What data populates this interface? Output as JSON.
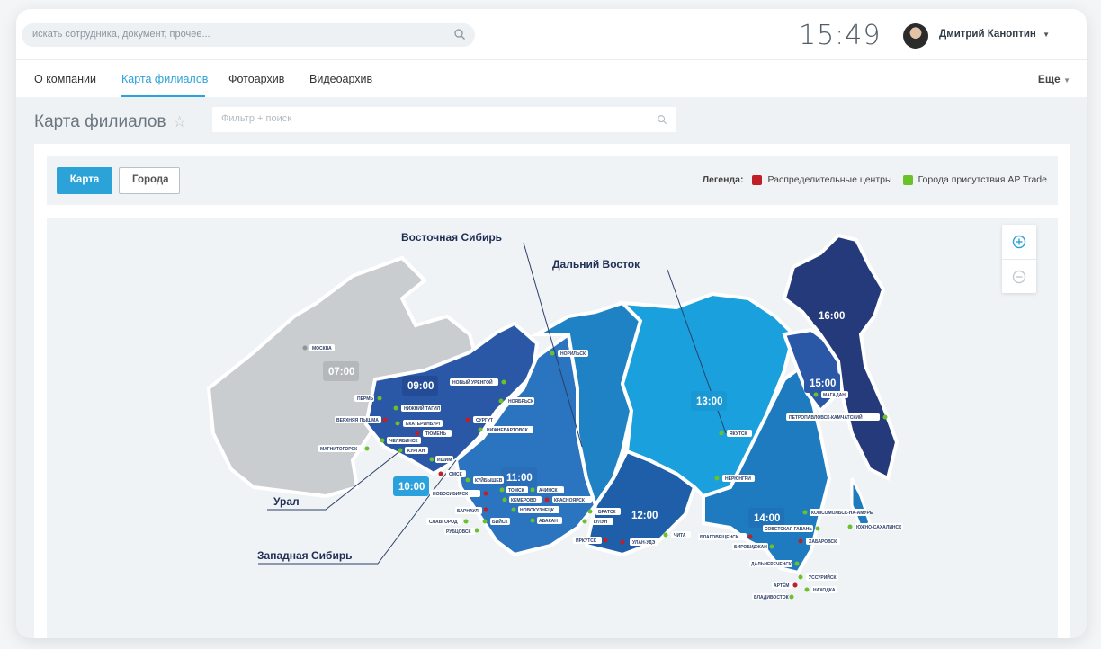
{
  "topbar": {
    "search_placeholder": "искать сотрудника, документ, прочее...",
    "clock": "15:49",
    "user_name": "Дмитрий Каноптин"
  },
  "tabs": {
    "items": [
      "О компании",
      "Карта филиалов",
      "Фотоархив",
      "Видеоархив"
    ],
    "active": "Карта филиалов",
    "more": "Еще"
  },
  "page": {
    "title": "Карта филиалов",
    "filter_placeholder": "Фильтр + поиск"
  },
  "toolbar": {
    "map_button": "Карта",
    "cities_button": "Города"
  },
  "legend": {
    "title": "Легенда:",
    "items": [
      {
        "label": "Распределительные центры",
        "color": "#c01f26"
      },
      {
        "label": "Города присутствия AP Trade",
        "color": "#6ac12a"
      }
    ]
  },
  "map": {
    "region_labels": [
      "Восточная Сибирь",
      "Дальний Восток",
      "Урал",
      "Западная Сибирь"
    ],
    "time_zones": [
      "07:00",
      "09:00",
      "10:00",
      "11:00",
      "12:00",
      "13:00",
      "14:00",
      "15:00",
      "16:00"
    ],
    "cities": [
      "МОСКВА",
      "ПЕРМЬ",
      "НИЖНИЙ ТАГИЛ",
      "ВЕРХНЯЯ ПЫШМА",
      "ЕКАТЕРИНБУРГ",
      "ТЮМЕНЬ",
      "ЧЕЛЯБИНСК",
      "КУРГАН",
      "МАГНИТОГОРСК",
      "ИШИМ",
      "НОВЫЙ УРЕНГОЙ",
      "НОЯБРЬСК",
      "СУРГУТ",
      "НИЖНЕВАРТОВСК",
      "ОМСК",
      "КУЙБЫШЕВ",
      "НОВОСИБИРСК",
      "ТОМСК",
      "АЧИНСК",
      "КЕМЕРОВО",
      "КРАСНОЯРСК",
      "НОВОКУЗНЕЦК",
      "БАРНАУЛ",
      "СЛАВГОРОД",
      "БИЙСК",
      "РУБЦОВСК",
      "АБАКАН",
      "БРАТСК",
      "ТУЛУН",
      "ИРКУТСК",
      "УЛАН-УДЭ",
      "ЧИТА",
      "НОРИЛЬСК",
      "ЯКУТСК",
      "НЕРЮНГРИ",
      "БЛАГОВЕЩЕНСК",
      "БИРОБИДЖАН",
      "ХАБАРОВСК",
      "КОМСОМОЛЬСК-НА-АМУРЕ",
      "СОВЕТСКАЯ ГАВАНЬ",
      "ЮЖНО-САХАЛИНСК",
      "ДАЛЬНЕРЕЧЕНСК",
      "УССУРИЙСК",
      "АРТЁМ",
      "НАХОДКА",
      "ВЛАДИВОСТОК",
      "МАГАДАН",
      "ПЕТРОПАВЛОВСК-КАМЧАТСКИЙ"
    ]
  }
}
